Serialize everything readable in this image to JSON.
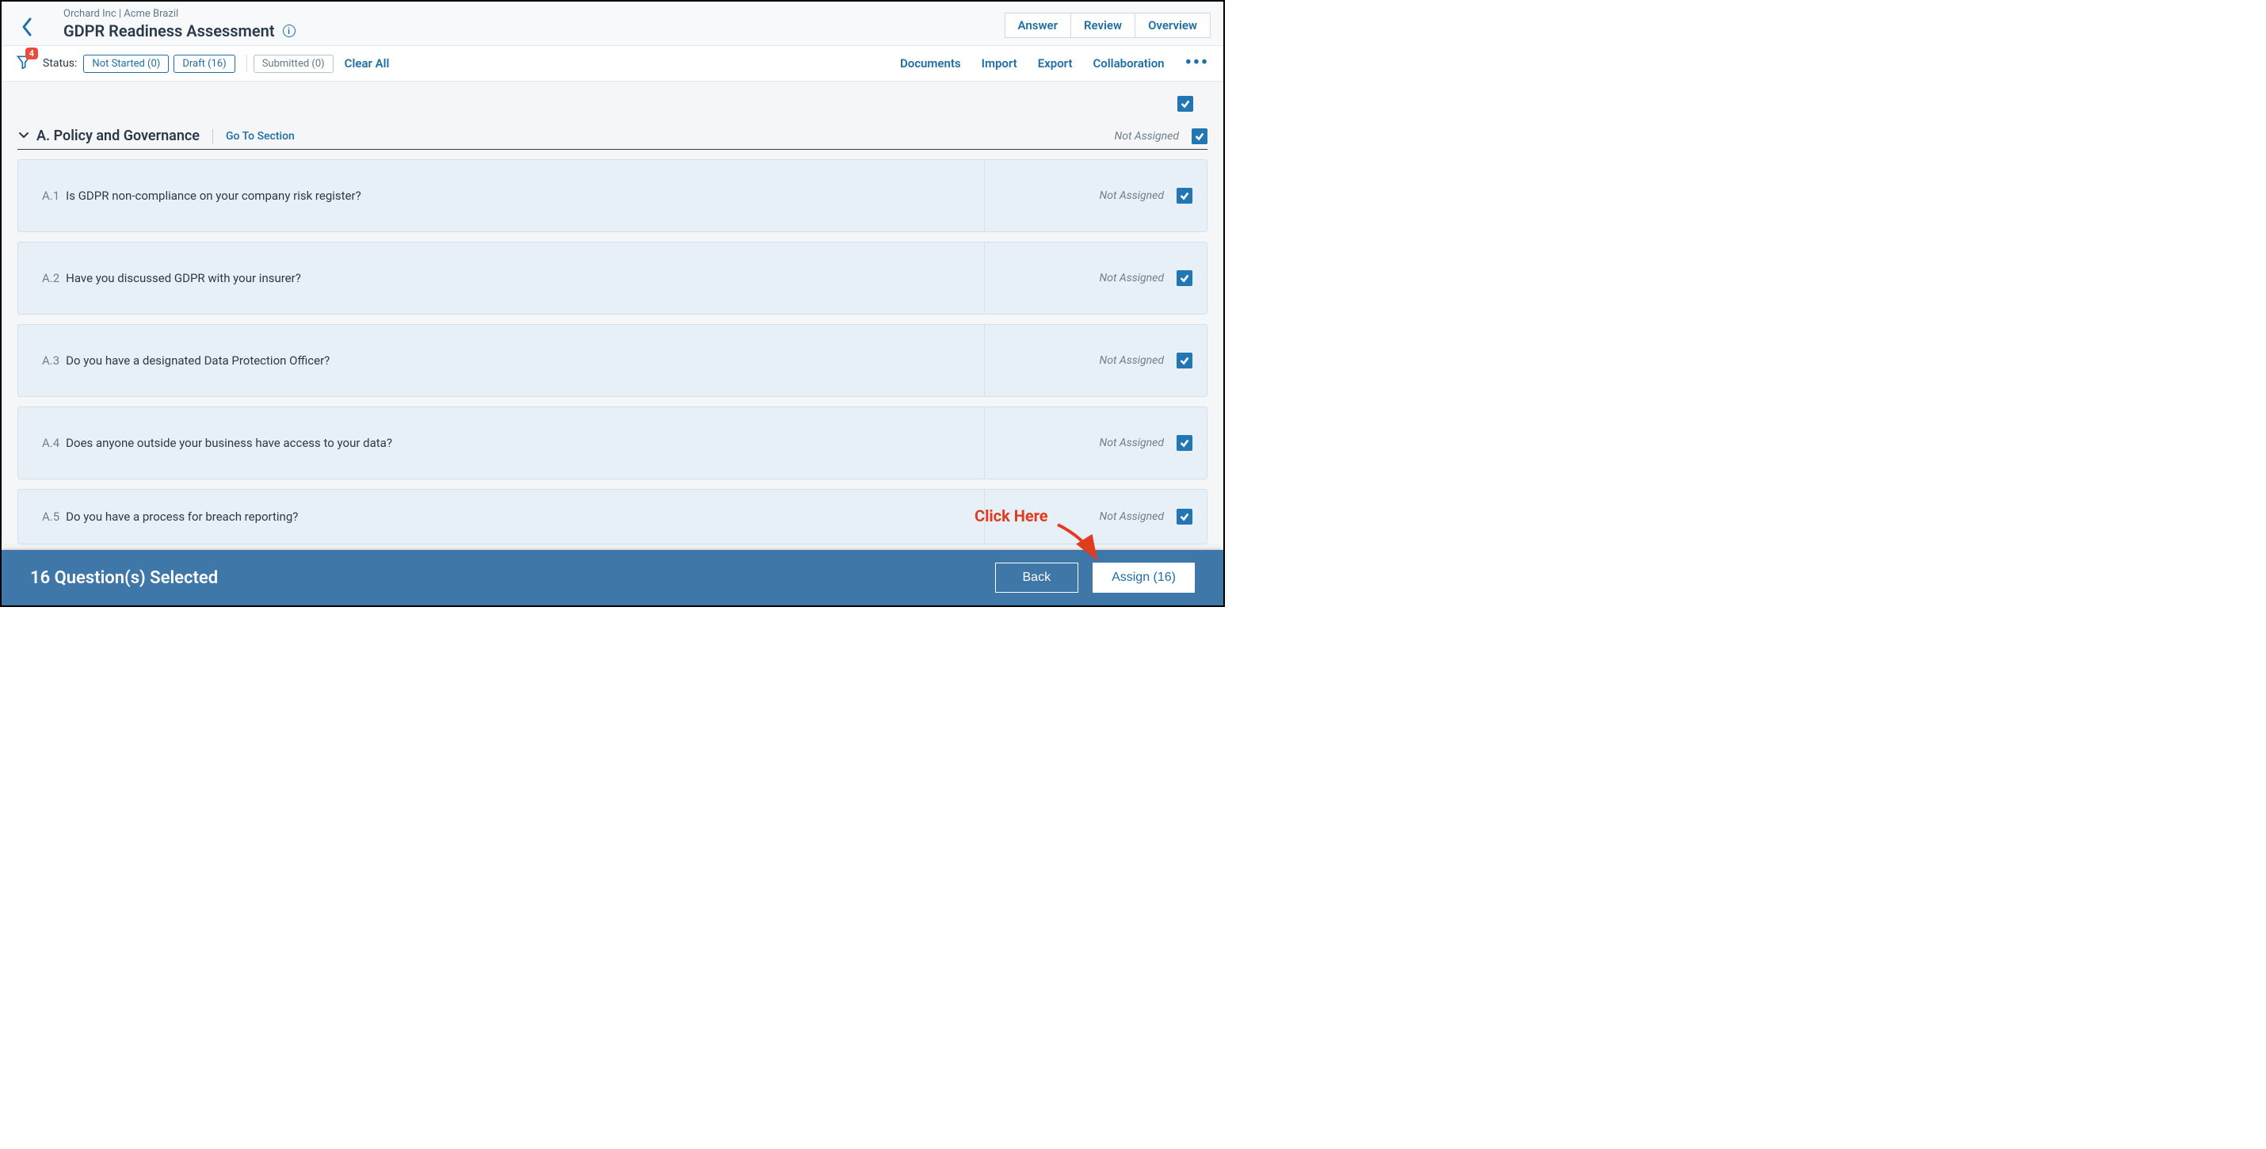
{
  "breadcrumb": "Orchard Inc | Acme Brazil",
  "title": "GDPR Readiness Assessment",
  "header_tabs": {
    "answer": "Answer",
    "review": "Review",
    "overview": "Overview"
  },
  "filter": {
    "badge": "4",
    "status_label": "Status:",
    "chips": [
      {
        "label": "Not Started (0)",
        "active": true
      },
      {
        "label": "Draft (16)",
        "active": true
      },
      {
        "label": "Submitted (0)",
        "active": false
      }
    ],
    "clear_all": "Clear All",
    "actions": {
      "documents": "Documents",
      "import": "Import",
      "export": "Export",
      "collaboration": "Collaboration"
    }
  },
  "section": {
    "title": "A. Policy and Governance",
    "goto": "Go To Section",
    "status": "Not Assigned"
  },
  "questions": [
    {
      "num": "A.1",
      "text": "Is GDPR non-compliance on your company risk register?",
      "status": "Not Assigned"
    },
    {
      "num": "A.2",
      "text": "Have you discussed GDPR with your insurer?",
      "status": "Not Assigned"
    },
    {
      "num": "A.3",
      "text": "Do you have a designated Data Protection Officer?",
      "status": "Not Assigned"
    },
    {
      "num": "A.4",
      "text": "Does anyone outside your business have access to your data?",
      "status": "Not Assigned"
    },
    {
      "num": "A.5",
      "text": "Do you have a process for breach reporting?",
      "status": "Not Assigned"
    }
  ],
  "footer": {
    "selected_text": "16 Question(s) Selected",
    "back": "Back",
    "assign": "Assign (16)"
  },
  "annotation": {
    "label": "Click Here"
  }
}
